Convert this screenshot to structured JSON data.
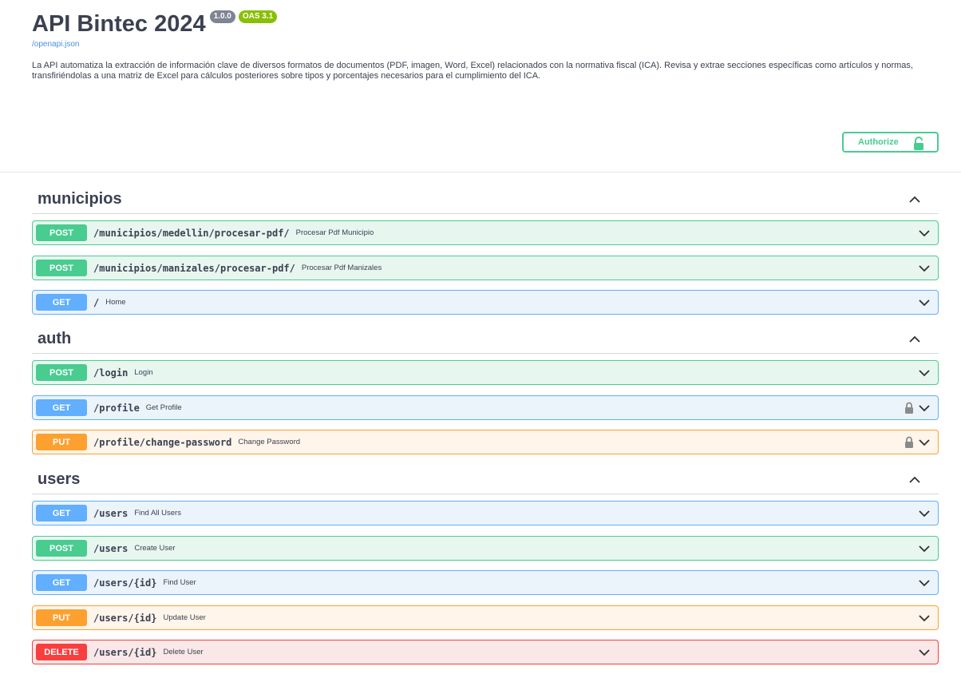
{
  "info": {
    "title": "API Bintec 2024",
    "version_badge": "1.0.0",
    "oas_badge": "OAS 3.1",
    "spec_link": "/openapi.json",
    "description": "La API automatiza la extracción de información clave de diversos formatos de documentos (PDF, imagen, Word, Excel) relacionados con la normativa fiscal (ICA). Revisa y extrae secciones específicas como artículos y normas, transfiriéndolas a una matriz de Excel para cálculos posteriores sobre tipos y porcentajes necesarios para el cumplimiento del ICA."
  },
  "authorize": {
    "label": "Authorize",
    "icon": "lock-open-icon"
  },
  "colors": {
    "post": "#49cc90",
    "get": "#61affe",
    "put": "#fca130",
    "delete": "#f93e3e"
  },
  "sections": [
    {
      "name": "municipios",
      "expanded": true,
      "operations": [
        {
          "method": "POST",
          "path": "/municipios/medellin/procesar-pdf/",
          "summary": "Procesar Pdf Municipio",
          "locked": false
        },
        {
          "method": "POST",
          "path": "/municipios/manizales/procesar-pdf/",
          "summary": "Procesar Pdf Manizales",
          "locked": false
        },
        {
          "method": "GET",
          "path": "/",
          "summary": "Home",
          "locked": false
        }
      ]
    },
    {
      "name": "auth",
      "expanded": true,
      "operations": [
        {
          "method": "POST",
          "path": "/login",
          "summary": "Login",
          "locked": false
        },
        {
          "method": "GET",
          "path": "/profile",
          "summary": "Get Profile",
          "locked": true
        },
        {
          "method": "PUT",
          "path": "/profile/change-password",
          "summary": "Change Password",
          "locked": true
        }
      ]
    },
    {
      "name": "users",
      "expanded": true,
      "operations": [
        {
          "method": "GET",
          "path": "/users",
          "summary": "Find All Users",
          "locked": false
        },
        {
          "method": "POST",
          "path": "/users",
          "summary": "Create User",
          "locked": false
        },
        {
          "method": "GET",
          "path": "/users/{id}",
          "summary": "Find User",
          "locked": false
        },
        {
          "method": "PUT",
          "path": "/users/{id}",
          "summary": "Update User",
          "locked": false
        },
        {
          "method": "DELETE",
          "path": "/users/{id}",
          "summary": "Delete User",
          "locked": false
        }
      ]
    }
  ]
}
